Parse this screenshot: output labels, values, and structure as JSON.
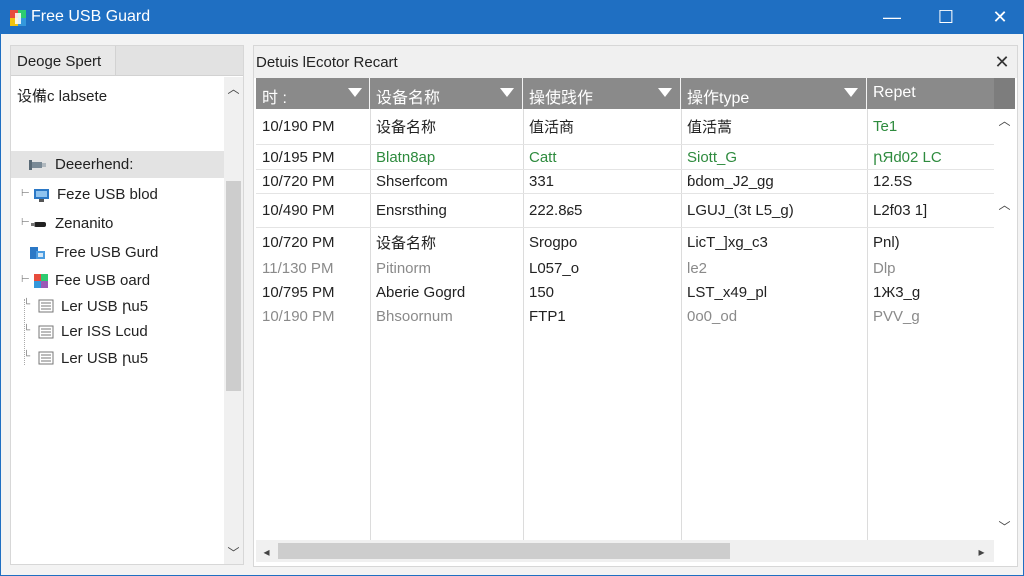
{
  "window": {
    "title": "Free USB Guard",
    "controls": {
      "minimize": "—",
      "maximize": "☐",
      "close": "✕"
    },
    "titlebar_color": "#1f6fc2"
  },
  "left_pane": {
    "tab_label": "Deoge Spert",
    "tree_header": "设備c labsete",
    "items": [
      {
        "label": "Deeerhend:",
        "icon": "usb-drive-icon",
        "selected": true
      },
      {
        "label": "Feze USB blod",
        "icon": "monitor-icon"
      },
      {
        "label": "Zenanito",
        "icon": "usb-stick-icon"
      },
      {
        "label": "Free USB Gurd",
        "icon": "devices-icon"
      },
      {
        "label": "Fee USB oard",
        "icon": "shield-color-icon"
      },
      {
        "label": "Ler USB ꞃu5",
        "icon": "log-file-icon"
      },
      {
        "label": "Ler ISS Lcud",
        "icon": "log-file-icon"
      },
      {
        "label": "Ler USB ꞃu5",
        "icon": "log-file-icon"
      }
    ]
  },
  "right_pane": {
    "title": "Detuis lEcotor Recart",
    "close": "✕",
    "columns": [
      {
        "label": "时 :"
      },
      {
        "label": "设备名称"
      },
      {
        "label": "操使践作"
      },
      {
        "label": "操作type"
      },
      {
        "label": "Repet"
      }
    ],
    "rows": [
      {
        "cells": [
          "10/190 PM",
          "设备名称",
          "值活商",
          "值活蒿",
          "Te1"
        ],
        "style": "normal"
      },
      {
        "cells": [
          "10/195 PM",
          "Blatn8ap",
          "Catt",
          "Siott_G",
          "ꞃЯd02 LC"
        ],
        "style": "green"
      },
      {
        "cells": [
          "10/720 PM",
          "Shserfcom",
          "331",
          "ɓdom_J2_ɡg",
          "12.5S"
        ],
        "style": "normal"
      },
      {
        "cells": [
          "10/490 PM",
          "Ensrsthing",
          "222.8ɕ5",
          "LGUJ_(3t L5_g)",
          "L2f03 1]"
        ],
        "style": "normal"
      },
      {
        "cells": [
          "10/720 PM",
          "设备名称",
          "Srogpo",
          "LicT_]xg_c3",
          "Pnl)"
        ],
        "style": "normal"
      },
      {
        "cells": [
          "11/130 PM",
          "Pitinorm",
          "L057_o",
          "le2",
          "Dlp"
        ],
        "style": "gray"
      },
      {
        "cells": [
          "10/795 PM",
          "Aberie Gogrd",
          "150",
          "LST_x49_pl",
          "1Ж3_g"
        ],
        "style": "normal"
      },
      {
        "cells": [
          "10/190 PM",
          "Bhsoornum",
          "FTP1",
          "0o0_od",
          "PVV_g"
        ],
        "style": "gray"
      }
    ]
  }
}
